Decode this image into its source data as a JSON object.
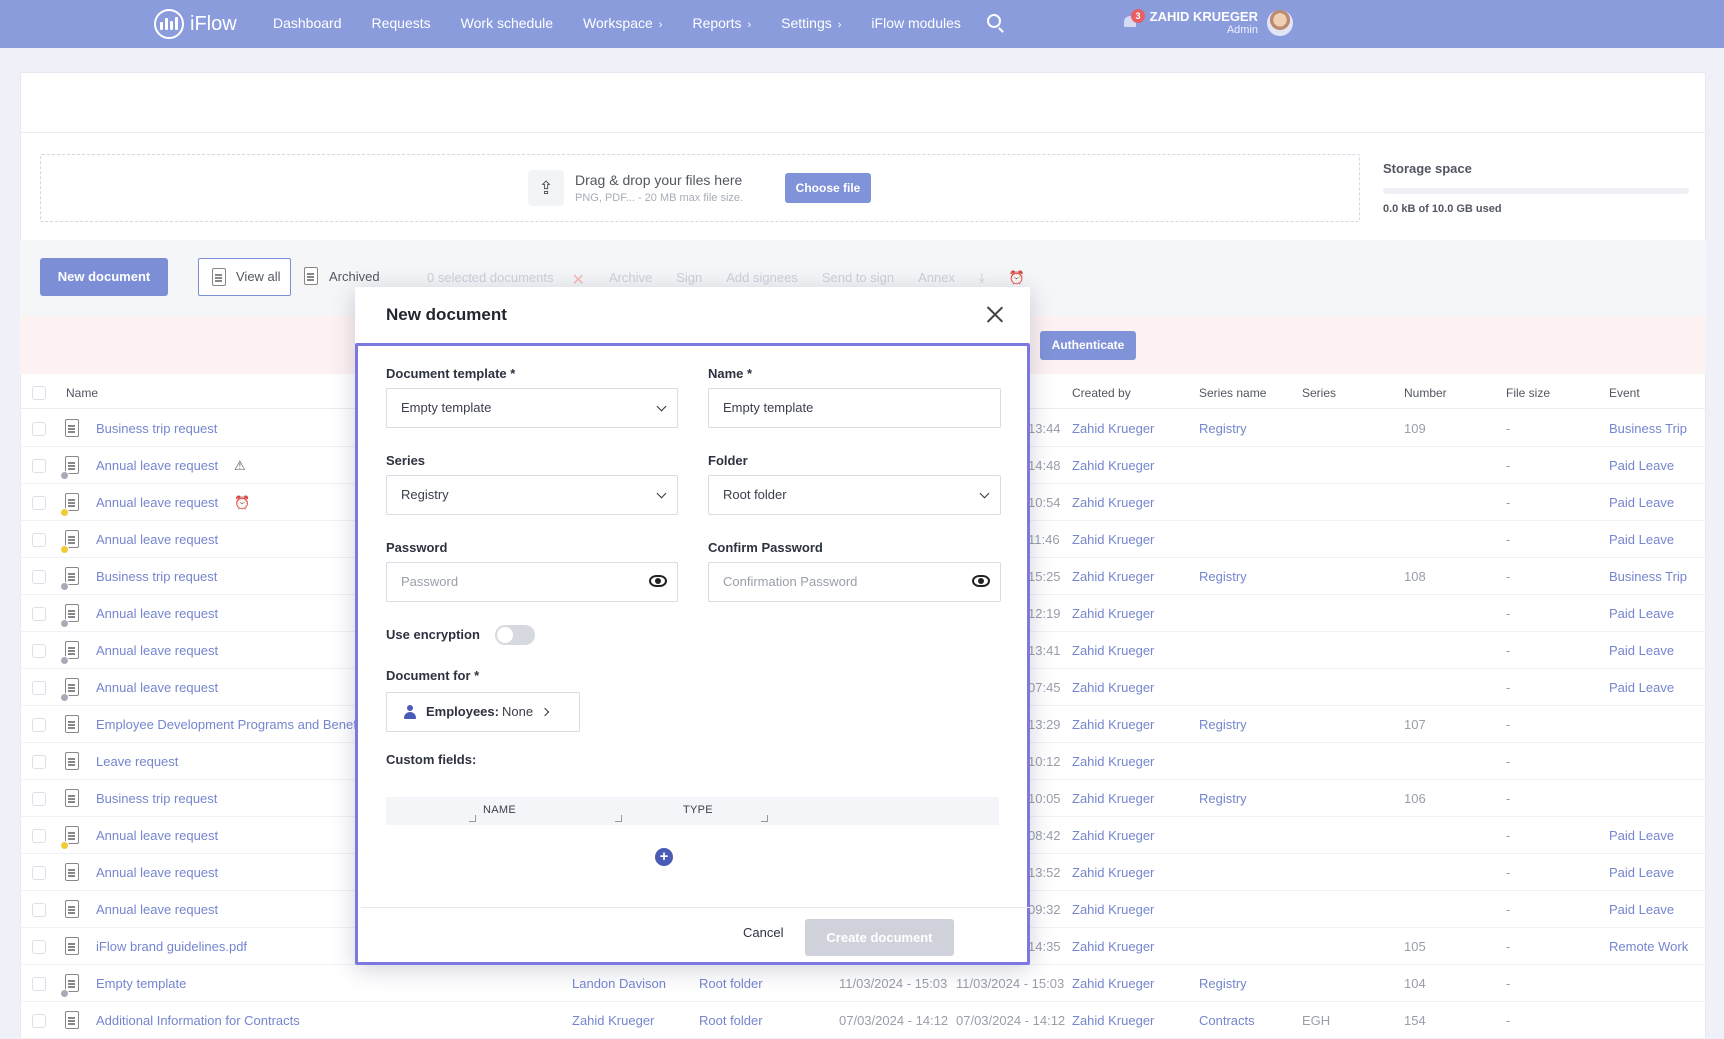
{
  "nav": {
    "brand": "iFlow",
    "items": [
      "Dashboard",
      "Requests",
      "Work schedule",
      "Workspace",
      "Reports",
      "Settings",
      "iFlow modules"
    ],
    "chevron_items": [
      false,
      false,
      false,
      true,
      true,
      true,
      false
    ],
    "notification_count": "3",
    "user_name": "ZAHID KRUEGER",
    "user_role": "Admin"
  },
  "upload": {
    "title": "Drag & drop your files here",
    "subtitle": "PNG, PDF... - 20 MB max file size.",
    "choose_label": "Choose file"
  },
  "storage": {
    "title": "Storage space",
    "used_text": "0.0 kB of 10.0 GB used",
    "used_fraction": 0
  },
  "toolbar": {
    "new_document": "New document",
    "view_all": "View all",
    "archived": "Archived",
    "selected": "0 selected documents",
    "actions": [
      "Archive",
      "Sign",
      "Add signees",
      "Send to sign",
      "Annex"
    ]
  },
  "alert": {
    "authenticate": "Authenticate"
  },
  "table": {
    "headers": {
      "name": "Name",
      "created_by": "Created by",
      "series_name": "Series name",
      "series": "Series",
      "number": "Number",
      "file_size": "File size",
      "event": "Event"
    },
    "rows": [
      {
        "name": "Business trip request",
        "time": "13:44",
        "created_by": "Zahid Krueger",
        "series_name": "Registry",
        "series": "",
        "number": "109",
        "size": "-",
        "event": "Business Trip",
        "flag": "",
        "status": ""
      },
      {
        "name": "Annual leave request",
        "time": "14:48",
        "created_by": "Zahid Krueger",
        "series_name": "",
        "series": "",
        "number": "",
        "size": "-",
        "event": "Paid Leave",
        "flag": "warn",
        "status": "grey"
      },
      {
        "name": "Annual leave request",
        "time": "10:54",
        "created_by": "Zahid Krueger",
        "series_name": "",
        "series": "",
        "number": "",
        "size": "-",
        "event": "Paid Leave",
        "flag": "alarm",
        "status": "yellow"
      },
      {
        "name": "Annual leave request",
        "time": "11:46",
        "created_by": "Zahid Krueger",
        "series_name": "",
        "series": "",
        "number": "",
        "size": "-",
        "event": "Paid Leave",
        "flag": "",
        "status": "yellow"
      },
      {
        "name": "Business trip request",
        "time": "15:25",
        "created_by": "Zahid Krueger",
        "series_name": "Registry",
        "series": "",
        "number": "108",
        "size": "-",
        "event": "Business Trip",
        "flag": "",
        "status": "grey"
      },
      {
        "name": "Annual leave request",
        "time": "12:19",
        "created_by": "Zahid Krueger",
        "series_name": "",
        "series": "",
        "number": "",
        "size": "-",
        "event": "Paid Leave",
        "flag": "",
        "status": "grey"
      },
      {
        "name": "Annual leave request",
        "time": "13:41",
        "created_by": "Zahid Krueger",
        "series_name": "",
        "series": "",
        "number": "",
        "size": "-",
        "event": "Paid Leave",
        "flag": "",
        "status": "grey"
      },
      {
        "name": "Annual leave request",
        "time": "07:45",
        "created_by": "Zahid Krueger",
        "series_name": "",
        "series": "",
        "number": "",
        "size": "-",
        "event": "Paid Leave",
        "flag": "",
        "status": "grey"
      },
      {
        "name": "Employee Development Programs and Benefits",
        "time": "13:29",
        "created_by": "Zahid Krueger",
        "series_name": "Registry",
        "series": "",
        "number": "107",
        "size": "-",
        "event": "",
        "flag": "",
        "status": ""
      },
      {
        "name": "Leave request",
        "time": "10:12",
        "created_by": "Zahid Krueger",
        "series_name": "",
        "series": "",
        "number": "",
        "size": "-",
        "event": "",
        "flag": "",
        "status": ""
      },
      {
        "name": "Business trip request",
        "time": "10:05",
        "created_by": "Zahid Krueger",
        "series_name": "Registry",
        "series": "",
        "number": "106",
        "size": "-",
        "event": "",
        "flag": "",
        "status": ""
      },
      {
        "name": "Annual leave request",
        "time": "08:42",
        "created_by": "Zahid Krueger",
        "series_name": "",
        "series": "",
        "number": "",
        "size": "-",
        "event": "Paid Leave",
        "flag": "",
        "status": "yellow"
      },
      {
        "name": "Annual leave request",
        "time": "13:52",
        "created_by": "Zahid Krueger",
        "series_name": "",
        "series": "",
        "number": "",
        "size": "-",
        "event": "Paid Leave",
        "flag": "",
        "status": ""
      },
      {
        "name": "Annual leave request",
        "time": "09:32",
        "created_by": "Zahid Krueger",
        "series_name": "",
        "series": "",
        "number": "",
        "size": "-",
        "event": "Paid Leave",
        "flag": "",
        "status": ""
      },
      {
        "name": "iFlow brand guidelines.pdf",
        "time": "14:35",
        "created_by": "Zahid Krueger",
        "series_name": "",
        "series": "",
        "number": "105",
        "size": "-",
        "event": "Remote Work",
        "flag": "",
        "status": ""
      },
      {
        "name": "Empty template",
        "owner": "Landon Davison",
        "folder": "Root folder",
        "created": "11/03/2024 - 15:03",
        "modified": "11/03/2024 - 15:03",
        "created_by": "Zahid Krueger",
        "series_name": "Registry",
        "series": "",
        "number": "104",
        "size": "-",
        "event": "",
        "flag": "",
        "status": "grey"
      },
      {
        "name": "Additional Information for Contracts",
        "owner": "Zahid Krueger",
        "folder": "Root folder",
        "created": "07/03/2024 - 14:12",
        "modified": "07/03/2024 - 14:12",
        "created_by": "Zahid Krueger",
        "series_name": "Contracts",
        "series": "EGH",
        "number": "154",
        "size": "-",
        "event": "",
        "flag": "",
        "status": ""
      }
    ]
  },
  "modal": {
    "title": "New document",
    "template_label": "Document template *",
    "template_value": "Empty template",
    "name_label": "Name *",
    "name_value": "Empty template",
    "series_label": "Series",
    "series_value": "Registry",
    "folder_label": "Folder",
    "folder_value": "Root folder",
    "password_label": "Password",
    "password_placeholder": "Password",
    "confirm_label": "Confirm Password",
    "confirm_placeholder": "Confirmation Password",
    "encryption_label": "Use encryption",
    "encryption_on": false,
    "doc_for_label": "Document for *",
    "employees_label": "Employees:",
    "employees_value": "None",
    "custom_fields_label": "Custom fields:",
    "cf_name": "NAME",
    "cf_type": "TYPE",
    "cancel": "Cancel",
    "create": "Create document"
  },
  "colors": {
    "nav": "#7b8fd9",
    "primary": "#6a7fd0",
    "link": "#6275c9",
    "modal_border": "#7b79e0"
  }
}
